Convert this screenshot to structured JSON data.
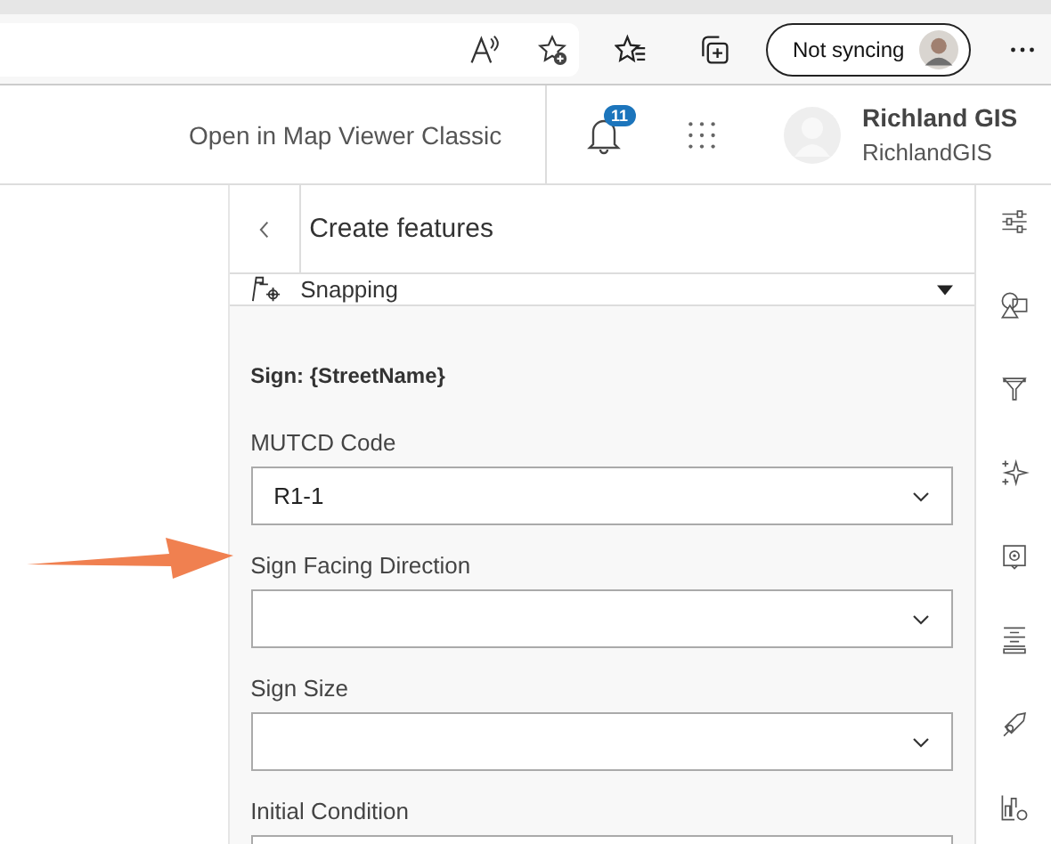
{
  "browser": {
    "sync_button": "Not syncing"
  },
  "header": {
    "link": "Open in Map Viewer Classic",
    "notifications": "11",
    "user": {
      "name": "Richland GIS",
      "username": "RichlandGIS"
    }
  },
  "panel": {
    "title": "Create features",
    "snapping": "Snapping",
    "form_title": "Sign: {StreetName}",
    "fields": [
      {
        "label": "MUTCD Code",
        "value": "R1-1"
      },
      {
        "label": "Sign Facing Direction"
      },
      {
        "label": "Sign Size"
      },
      {
        "label": "Initial Condition"
      }
    ]
  }
}
